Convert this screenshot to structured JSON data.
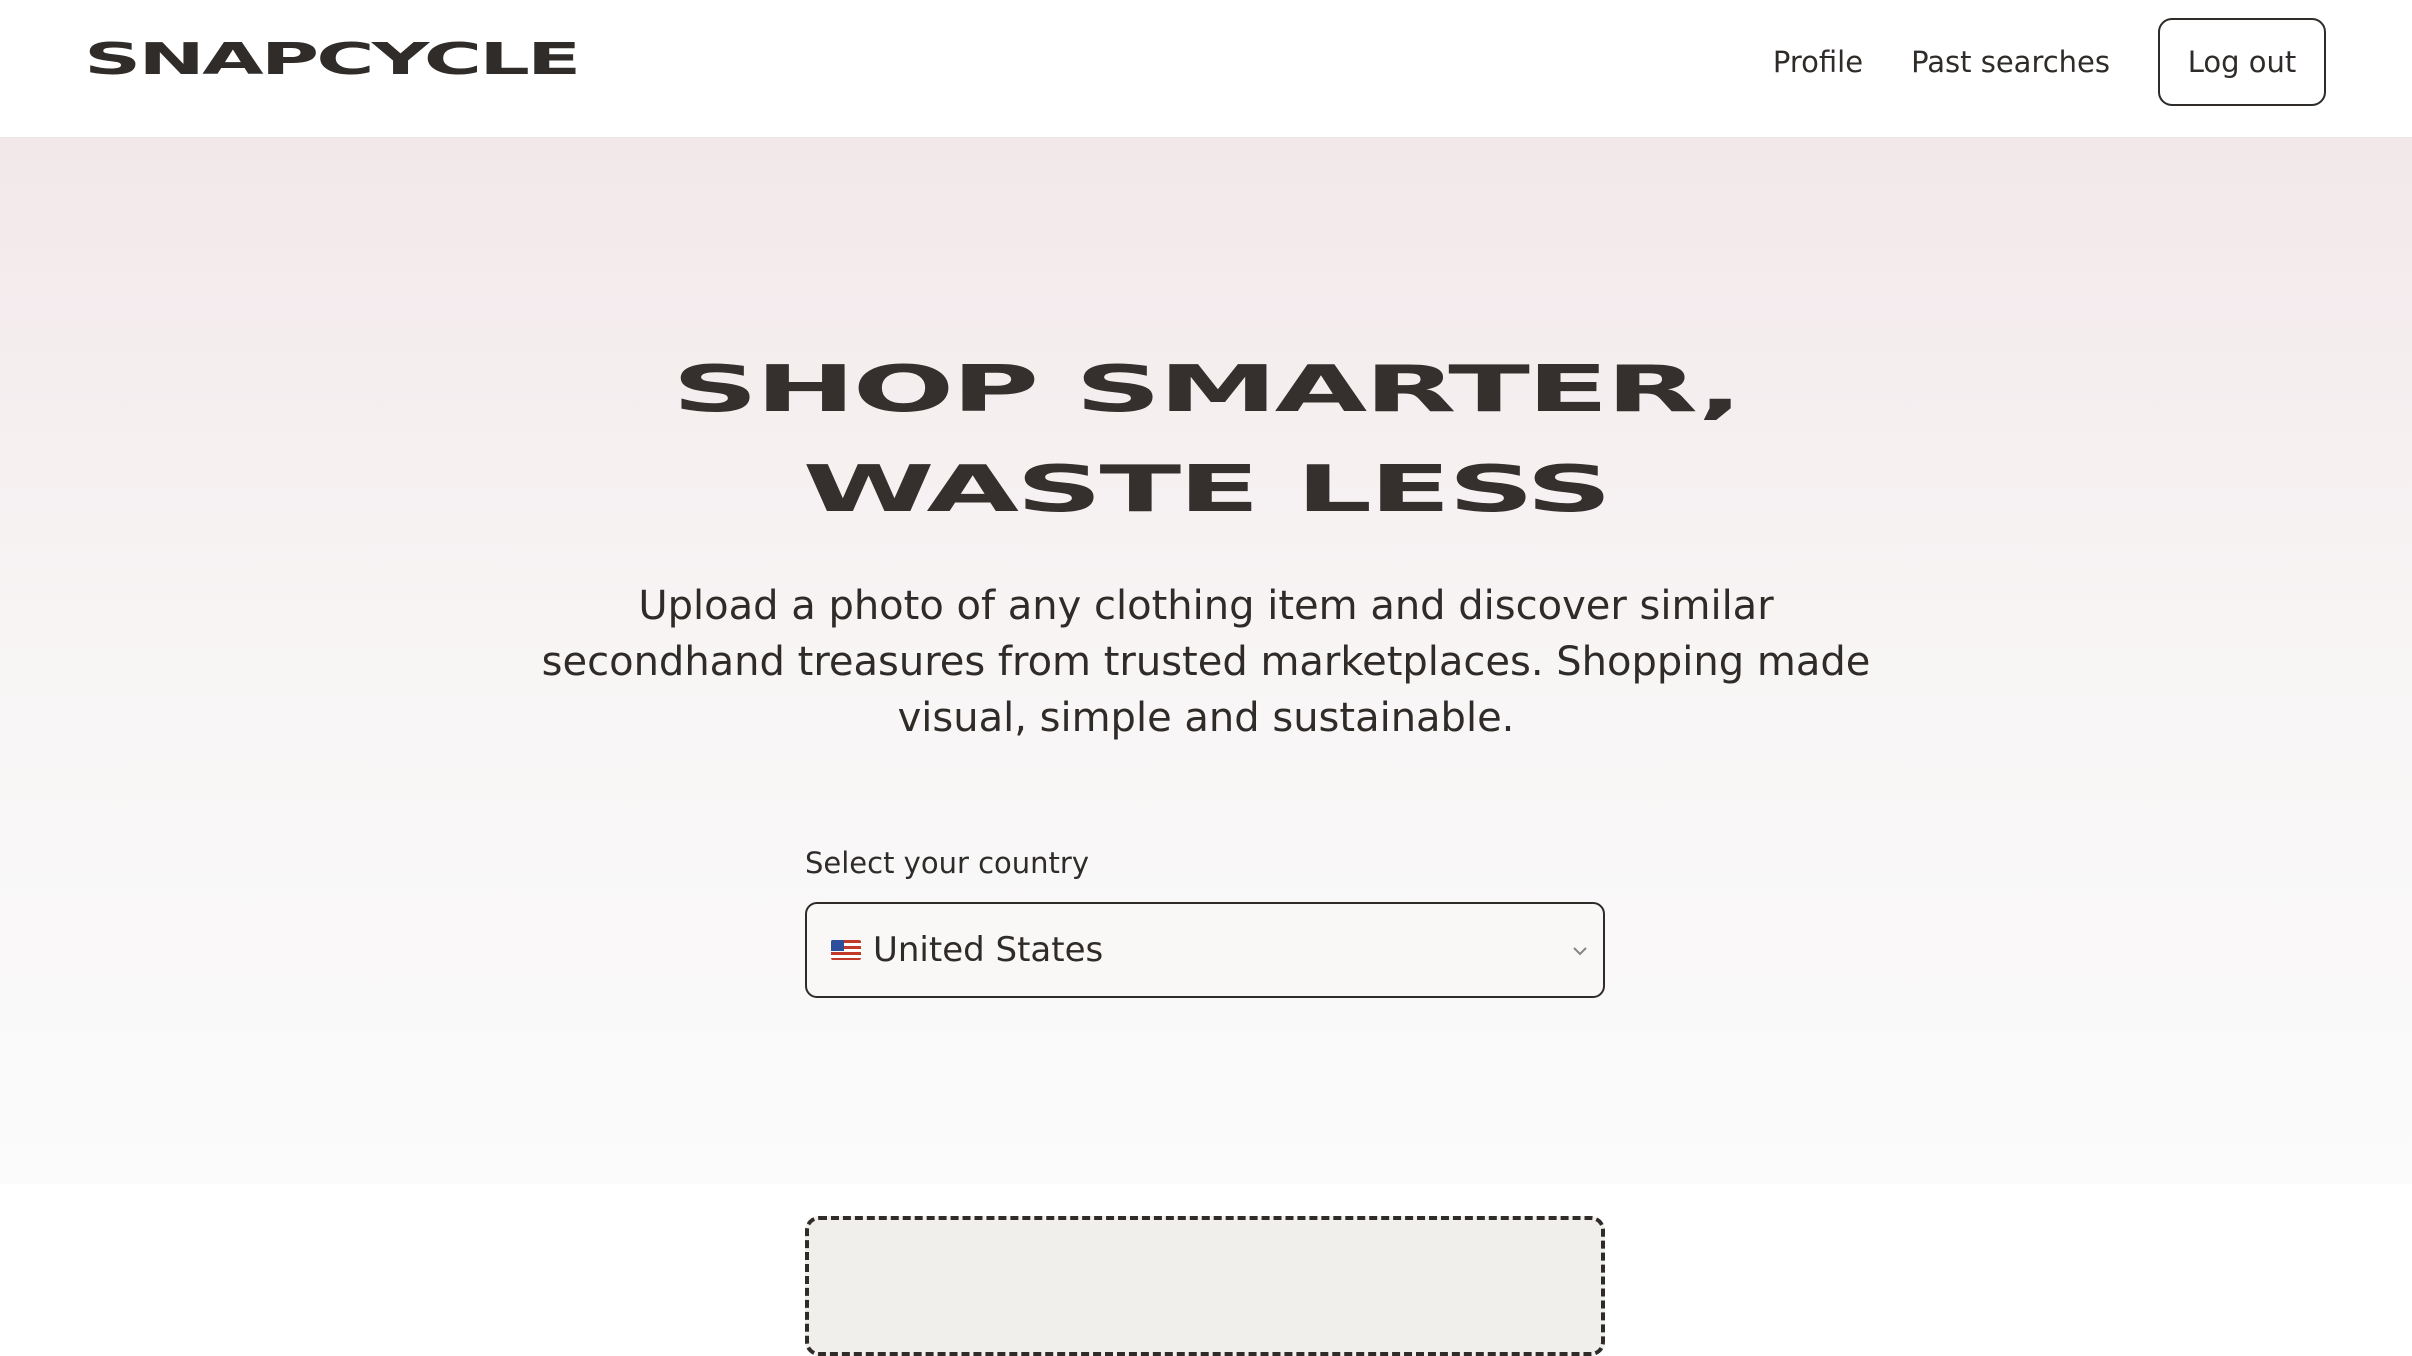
{
  "header": {
    "logo": "SNAPCYCLE",
    "nav": {
      "profile": "Profile",
      "past_searches": "Past searches",
      "logout": "Log out"
    }
  },
  "hero": {
    "title_line1": "SHOP SMARTER,",
    "title_line2": "WASTE LESS",
    "subtitle": "Upload a photo of any clothing item and discover similar secondhand treasures from trusted marketplaces. Shopping made visual, simple and sustainable."
  },
  "country": {
    "label": "Select your country",
    "selected": "United States",
    "flag_icon": "us-flag-icon"
  },
  "colors": {
    "text": "#2f2b29",
    "hero_top": "#f2e8ea",
    "hero_bottom": "#fbfbfb",
    "upload_bg": "#f0efec"
  }
}
